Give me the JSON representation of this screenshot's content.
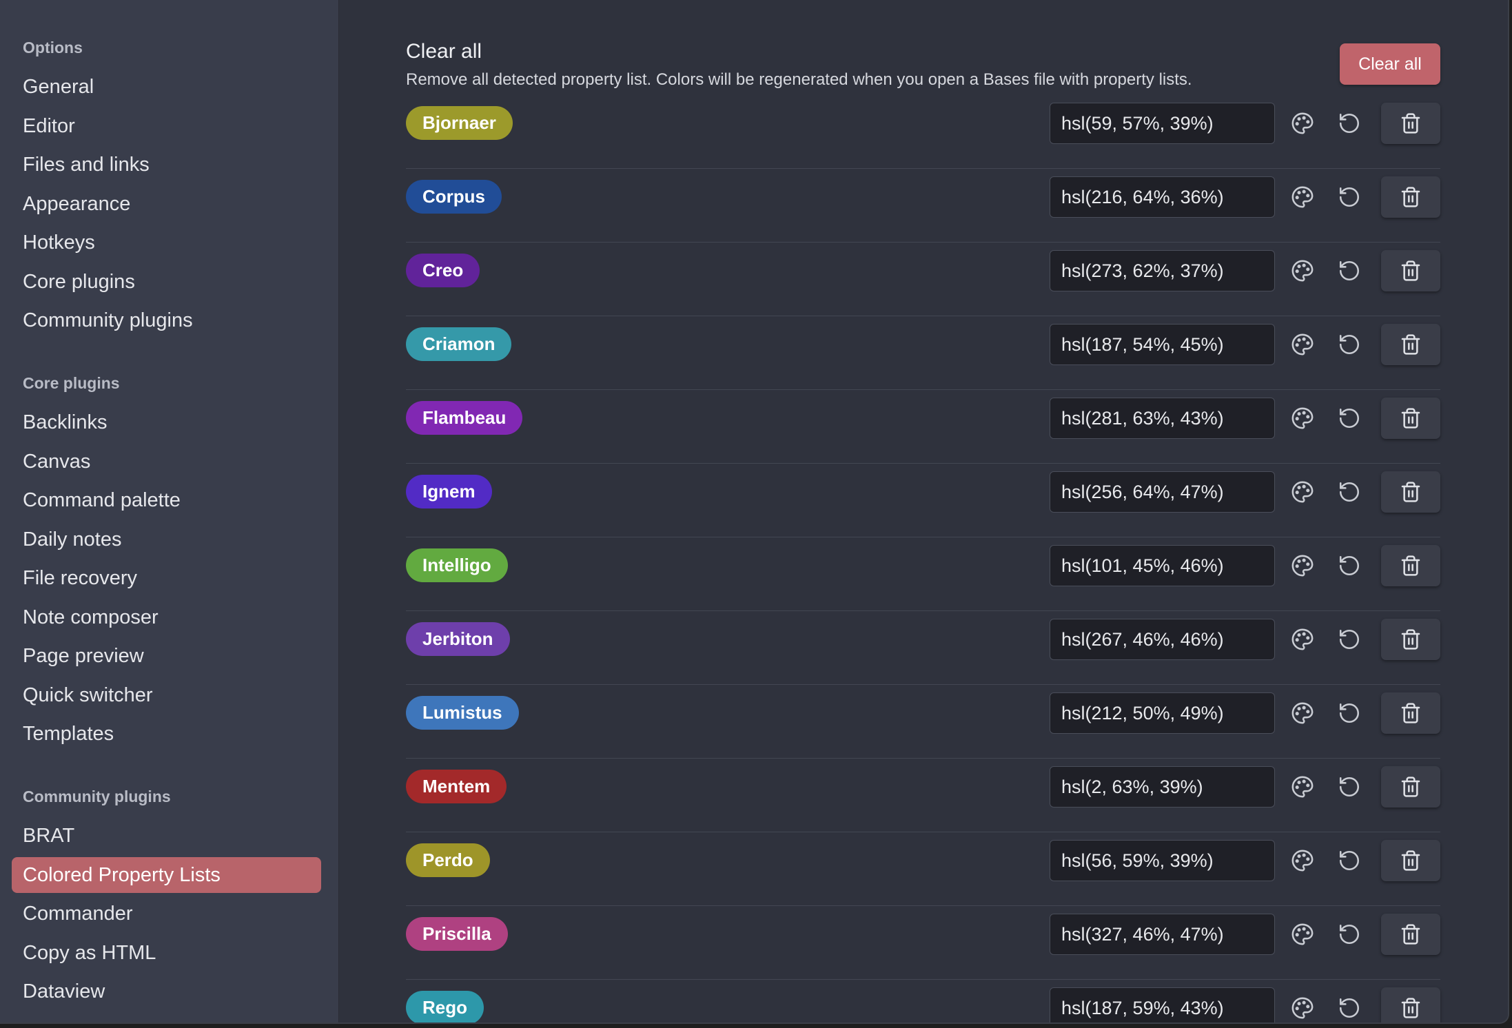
{
  "sidebar": {
    "groups": [
      {
        "heading": "Options",
        "items": [
          "General",
          "Editor",
          "Files and links",
          "Appearance",
          "Hotkeys",
          "Core plugins",
          "Community plugins"
        ]
      },
      {
        "heading": "Core plugins",
        "items": [
          "Backlinks",
          "Canvas",
          "Command palette",
          "Daily notes",
          "File recovery",
          "Note composer",
          "Page preview",
          "Quick switcher",
          "Templates"
        ]
      },
      {
        "heading": "Community plugins",
        "items": [
          "BRAT",
          "Colored Property Lists",
          "Commander",
          "Copy as HTML",
          "Dataview"
        ]
      }
    ],
    "active_item": "Colored Property Lists",
    "active_color": "#b8646a"
  },
  "header": {
    "title": "Clear all",
    "description": "Remove all detected property list. Colors will be regenerated when you open a Bases file with property lists.",
    "clear_button_label": "Clear all"
  },
  "icons": {
    "palette": "palette-icon",
    "reset": "reset-icon",
    "delete": "trash-icon"
  },
  "properties": [
    {
      "name": "Bjornaer",
      "hsl": "hsl(59, 57%, 39%)",
      "color": "#9c9a2b"
    },
    {
      "name": "Corpus",
      "hsl": "hsl(216, 64%, 36%)",
      "color": "#214d97"
    },
    {
      "name": "Creo",
      "hsl": "hsl(273, 62%, 37%)",
      "color": "#61239a"
    },
    {
      "name": "Criamon",
      "hsl": "hsl(187, 54%, 45%)",
      "color": "#3599a9"
    },
    {
      "name": "Flambeau",
      "hsl": "hsl(281, 63%, 43%)",
      "color": "#8128b3"
    },
    {
      "name": "Ignem",
      "hsl": "hsl(256, 64%, 47%)",
      "color": "#522bc5"
    },
    {
      "name": "Intelligo",
      "hsl": "hsl(101, 45%, 46%)",
      "color": "#62aa40"
    },
    {
      "name": "Jerbiton",
      "hsl": "hsl(267, 46%, 46%)",
      "color": "#6e3fab"
    },
    {
      "name": "Lumistus",
      "hsl": "hsl(212, 50%, 49%)",
      "color": "#3e76bb"
    },
    {
      "name": "Mentem",
      "hsl": "hsl(2, 63%, 39%)",
      "color": "#a3292a"
    },
    {
      "name": "Perdo",
      "hsl": "hsl(56, 59%, 39%)",
      "color": "#9e9529"
    },
    {
      "name": "Priscilla",
      "hsl": "hsl(327, 46%, 47%)",
      "color": "#af4181"
    },
    {
      "name": "Rego",
      "hsl": "hsl(187, 59%, 43%)",
      "color": "#2d98aa"
    }
  ]
}
